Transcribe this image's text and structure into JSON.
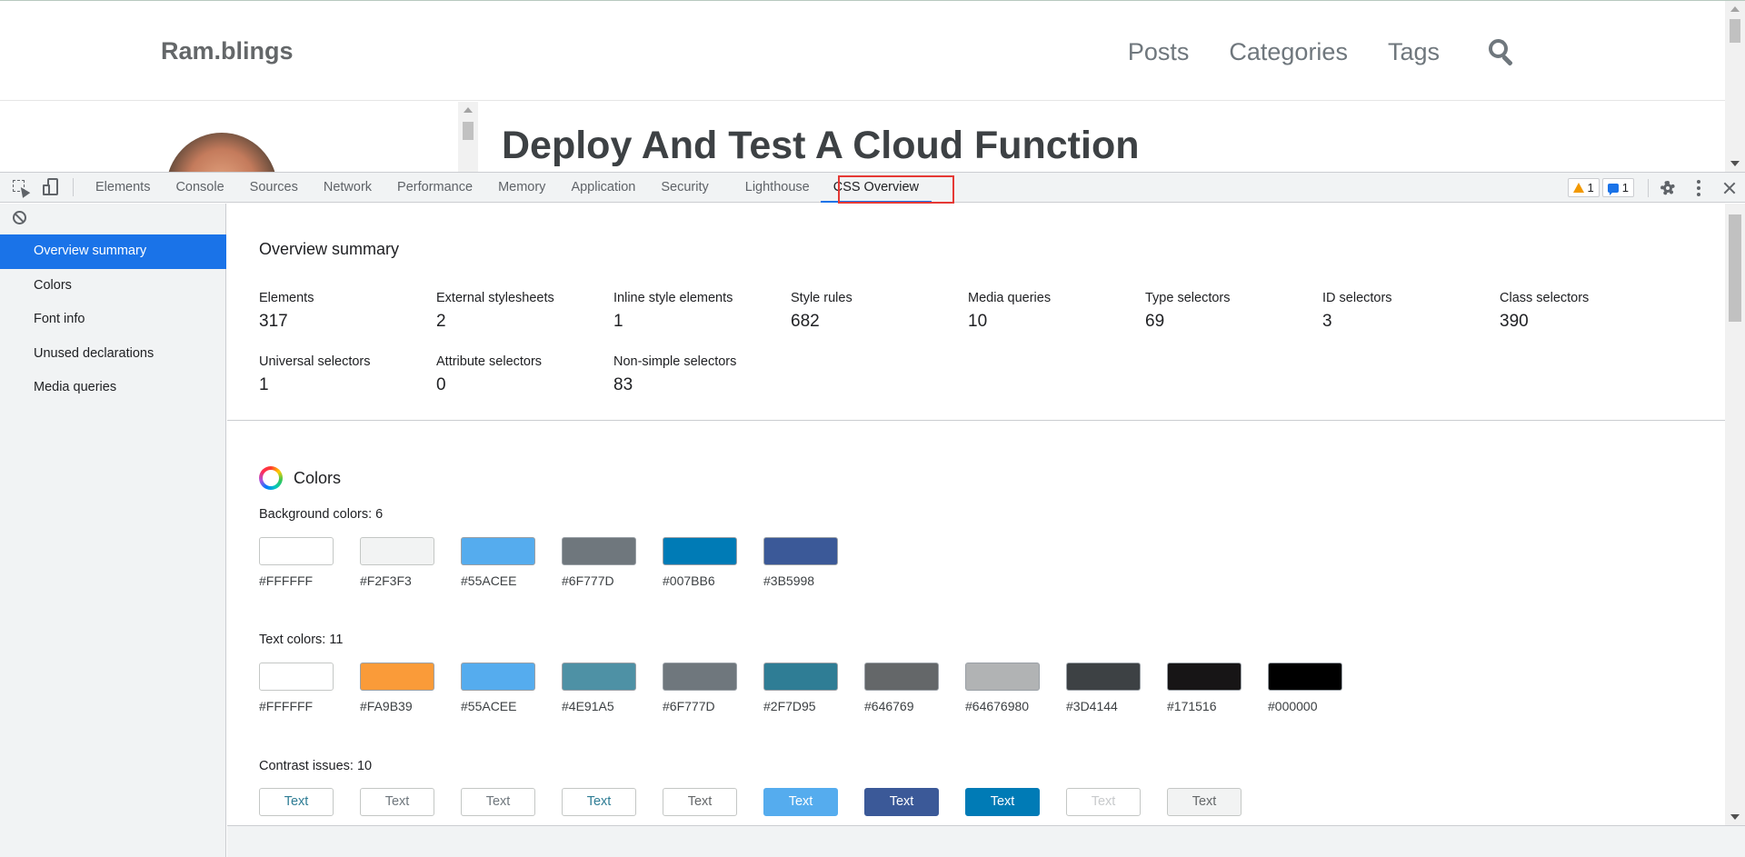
{
  "site": {
    "brand": "Ram.blings",
    "nav": [
      "Posts",
      "Categories",
      "Tags"
    ],
    "post_title": "Deploy And Test A Cloud Function"
  },
  "devtools": {
    "tabs": [
      "Elements",
      "Console",
      "Sources",
      "Network",
      "Performance",
      "Memory",
      "Application",
      "Security",
      "Lighthouse",
      "CSS Overview"
    ],
    "active_tab": "CSS Overview",
    "warnings_count": "1",
    "messages_count": "1",
    "sidebar": [
      "Overview summary",
      "Colors",
      "Font info",
      "Unused declarations",
      "Media queries"
    ],
    "selected_sidebar": "Overview summary",
    "summary": {
      "title": "Overview summary",
      "stats": [
        {
          "label": "Elements",
          "value": "317"
        },
        {
          "label": "External stylesheets",
          "value": "2"
        },
        {
          "label": "Inline style elements",
          "value": "1"
        },
        {
          "label": "Style rules",
          "value": "682"
        },
        {
          "label": "Media queries",
          "value": "10"
        },
        {
          "label": "Type selectors",
          "value": "69"
        },
        {
          "label": "ID selectors",
          "value": "3"
        },
        {
          "label": "Class selectors",
          "value": "390"
        },
        {
          "label": "Universal selectors",
          "value": "1"
        },
        {
          "label": "Attribute selectors",
          "value": "0"
        },
        {
          "label": "Non-simple selectors",
          "value": "83"
        }
      ]
    },
    "colors": {
      "title": "Colors",
      "background_title": "Background colors: 6",
      "background": [
        "#FFFFFF",
        "#F2F3F3",
        "#55ACEE",
        "#6F777D",
        "#007BB6",
        "#3B5998"
      ],
      "text_title": "Text colors: 11",
      "text": [
        "#FFFFFF",
        "#FA9B39",
        "#55ACEE",
        "#4E91A5",
        "#6F777D",
        "#2F7D95",
        "#646769",
        "#64676980",
        "#3D4144",
        "#171516",
        "#000000"
      ],
      "contrast_title": "Contrast issues: 10",
      "contrast": [
        {
          "label": "Text",
          "fg": "#2F7D95",
          "bg": "#FFFFFF"
        },
        {
          "label": "Text",
          "fg": "#6F777D",
          "bg": "#FFFFFF"
        },
        {
          "label": "Text",
          "fg": "#6F777D",
          "bg": "#FFFFFF"
        },
        {
          "label": "Text",
          "fg": "#2F7D95",
          "bg": "#FFFFFF"
        },
        {
          "label": "Text",
          "fg": "#646769",
          "bg": "#FFFFFF"
        },
        {
          "label": "Text",
          "fg": "#FFFFFF",
          "bg": "#55ACEE"
        },
        {
          "label": "Text",
          "fg": "#FFFFFF",
          "bg": "#3B5998"
        },
        {
          "label": "Text",
          "fg": "#FFFFFF",
          "bg": "#007BB6"
        },
        {
          "label": "Text",
          "fg": "#C8CACC",
          "bg": "#FFFFFF"
        },
        {
          "label": "Text",
          "fg": "#646769",
          "bg": "#F2F3F3"
        }
      ]
    }
  }
}
